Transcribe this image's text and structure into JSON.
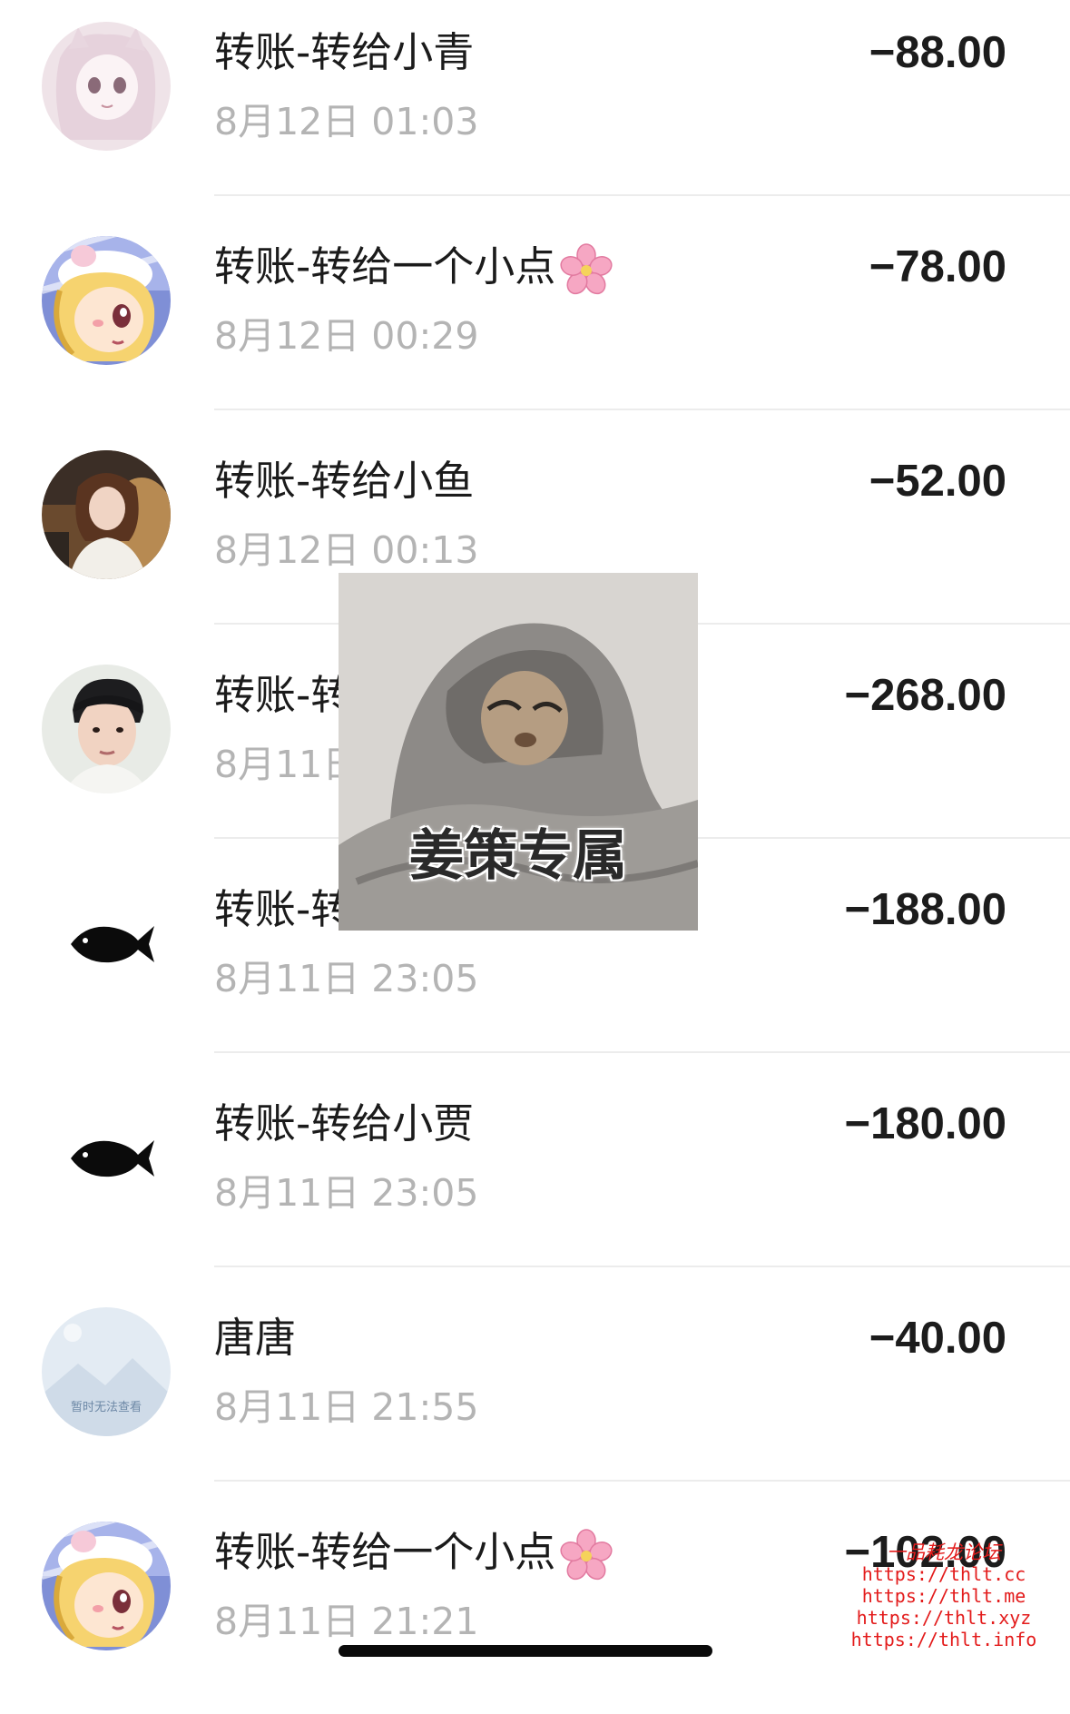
{
  "transactions": [
    {
      "title": "转账-转给小青",
      "time": "8月12日 01:03",
      "amount": "−88.00",
      "has_flower": false,
      "avatar": "anime-girl-pink-avatar"
    },
    {
      "title": "转账-转给一个小点",
      "time": "8月12日 00:29",
      "amount": "−78.00",
      "has_flower": true,
      "avatar": "cartoon-girl-avatar"
    },
    {
      "title": "转账-转给小鱼",
      "time": "8月12日 00:13",
      "amount": "−52.00",
      "has_flower": false,
      "avatar": "photo-girl-avatar"
    },
    {
      "title": "转账-转",
      "time": "8月11日",
      "amount": "−268.00",
      "has_flower": false,
      "avatar": "photo-boy-avatar"
    },
    {
      "title": "转账-转",
      "time": "8月11日 23:05",
      "amount": "−188.00",
      "has_flower": false,
      "avatar": "black-fish-avatar"
    },
    {
      "title": "转账-转给小贾",
      "time": "8月11日 23:05",
      "amount": "−180.00",
      "has_flower": false,
      "avatar": "black-fish-avatar"
    },
    {
      "title": "唐唐",
      "time": "8月11日 21:55",
      "amount": "−40.00",
      "has_flower": false,
      "avatar": "image-unavailable-avatar",
      "avatar_placeholder_text": "暂时无法查看"
    },
    {
      "title": "转账-转给一个小点",
      "time": "8月11日 21:21",
      "amount": "−102.00",
      "has_flower": true,
      "avatar": "cartoon-girl-avatar"
    }
  ],
  "sticker": {
    "caption": "姜策专属",
    "icon": "cat-in-blanket-sticker"
  },
  "watermark": {
    "title": "一品耗龙论坛",
    "lines": [
      "https://thlt.cc",
      "https://thlt.me",
      "https://thlt.xyz",
      "https://thlt.info"
    ]
  },
  "colors": {
    "amount": "#1c1c1c",
    "title": "#1b1b1b",
    "time": "#b4b4b4",
    "watermark": "#e31b1b"
  }
}
